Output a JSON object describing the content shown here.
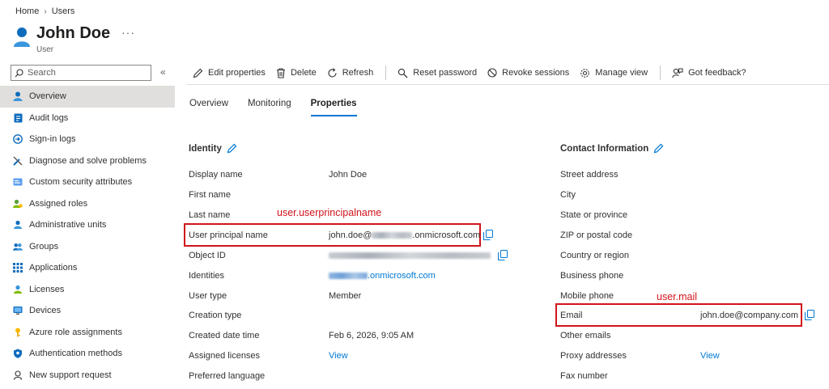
{
  "breadcrumb": {
    "home": "Home",
    "separator": "›",
    "users": "Users"
  },
  "header": {
    "title": "John Doe",
    "subtitle": "User",
    "more": "···"
  },
  "search": {
    "placeholder": "Search",
    "collapse": "«"
  },
  "sidebar": {
    "items": [
      {
        "label": "Overview",
        "icon": "user-icon",
        "active": true
      },
      {
        "label": "Audit logs",
        "icon": "audit-log-icon"
      },
      {
        "label": "Sign-in logs",
        "icon": "sign-in-icon"
      },
      {
        "label": "Diagnose and solve problems",
        "icon": "wrench-icon"
      },
      {
        "label": "Custom security attributes",
        "icon": "attributes-icon"
      },
      {
        "label": "Assigned roles",
        "icon": "roles-icon"
      },
      {
        "label": "Administrative units",
        "icon": "admin-units-icon"
      },
      {
        "label": "Groups",
        "icon": "groups-icon"
      },
      {
        "label": "Applications",
        "icon": "apps-grid-icon"
      },
      {
        "label": "Licenses",
        "icon": "license-icon"
      },
      {
        "label": "Devices",
        "icon": "device-icon"
      },
      {
        "label": "Azure role assignments",
        "icon": "key-icon"
      },
      {
        "label": "Authentication methods",
        "icon": "shield-icon"
      },
      {
        "label": "New support request",
        "icon": "support-icon"
      }
    ]
  },
  "toolbar": {
    "edit": "Edit properties",
    "delete": "Delete",
    "refresh": "Refresh",
    "reset": "Reset password",
    "revoke": "Revoke sessions",
    "manage": "Manage view",
    "feedback": "Got feedback?"
  },
  "tabs": {
    "overview": "Overview",
    "monitoring": "Monitoring",
    "properties": "Properties"
  },
  "identity": {
    "title": "Identity",
    "display_name_label": "Display name",
    "display_name_value": "John Doe",
    "first_name_label": "First name",
    "last_name_label": "Last name",
    "upn_label": "User principal name",
    "upn_value_prefix": "john.doe@",
    "upn_value_suffix": ".onmicrosoft.com",
    "object_id_label": "Object ID",
    "identities_label": "Identities",
    "identities_suffix": ".onmicrosoft.com",
    "user_type_label": "User type",
    "user_type_value": "Member",
    "creation_type_label": "Creation type",
    "created_label": "Created date time",
    "created_value": "Feb 6, 2026, 9:05 AM",
    "licenses_label": "Assigned licenses",
    "licenses_value": "View",
    "language_label": "Preferred language"
  },
  "contact": {
    "title": "Contact Information",
    "street_label": "Street address",
    "city_label": "City",
    "state_label": "State or province",
    "zip_label": "ZIP or postal code",
    "country_label": "Country or region",
    "business_phone_label": "Business phone",
    "mobile_label": "Mobile phone",
    "email_label": "Email",
    "email_value": "john.doe@company.com",
    "other_emails_label": "Other emails",
    "proxy_label": "Proxy addresses",
    "proxy_value": "View",
    "fax_label": "Fax number"
  },
  "annotations": {
    "upn": "user.userprincipalname",
    "mail": "user.mail"
  },
  "colors": {
    "accent": "#0078d4",
    "annotation": "#d1141b",
    "active_bg": "#e1dfdd"
  }
}
